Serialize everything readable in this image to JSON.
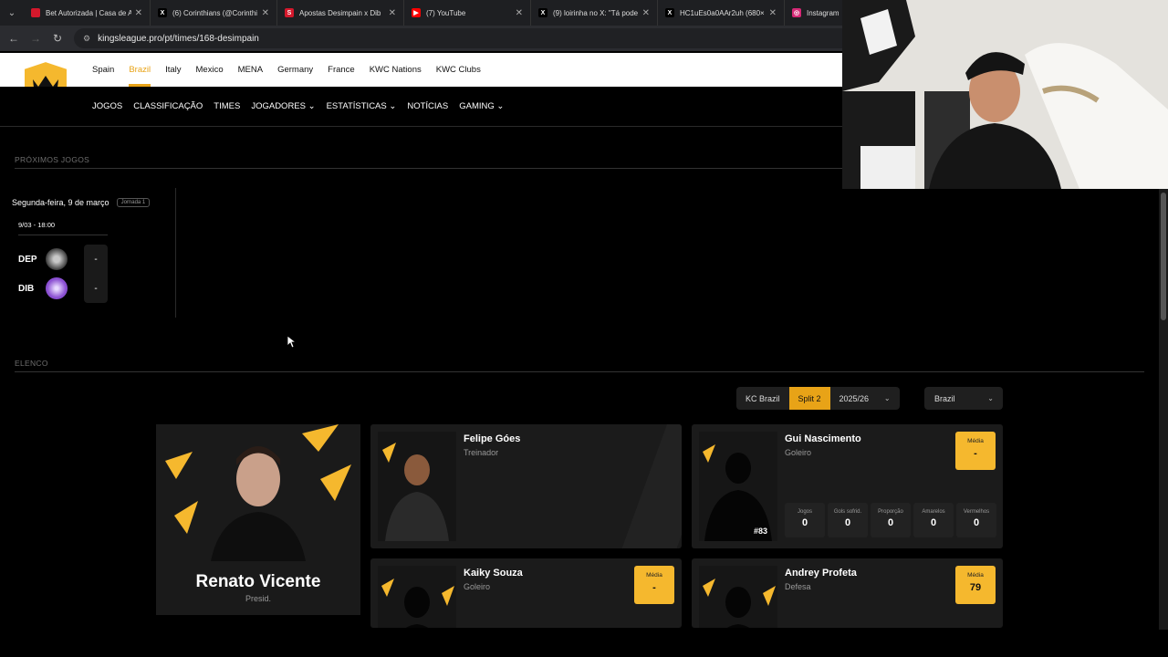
{
  "browser": {
    "tabs": [
      {
        "title": "Bet Autorizada | Casa de A",
        "icon_color": "#d4182c",
        "glyph": ""
      },
      {
        "title": "(6) Corinthians (@Corinthi",
        "icon_color": "#000000",
        "glyph": "X"
      },
      {
        "title": "Apostas Desimpain x Dib",
        "icon_color": "#d4182c",
        "glyph": "S"
      },
      {
        "title": "(7) YouTube",
        "icon_color": "#ff0000",
        "glyph": "▶"
      },
      {
        "title": "(9) loirinha no X: \"Tá pode",
        "icon_color": "#000000",
        "glyph": "X"
      },
      {
        "title": "HC1uEs0a0AAr2uh (680×",
        "icon_color": "#000000",
        "glyph": "X"
      },
      {
        "title": "Instagram",
        "icon_color": "#d62976",
        "glyph": "◎"
      }
    ],
    "url": "kingsleague.pro/pt/times/168-desimpain"
  },
  "site": {
    "regions": [
      "Spain",
      "Brazil",
      "Italy",
      "Mexico",
      "MENA",
      "Germany",
      "France",
      "KWC Nations",
      "KWC Clubs"
    ],
    "active_region": "Brazil",
    "main_nav": [
      "JOGOS",
      "CLASSIFICAÇÃO",
      "TIMES",
      "JOGADORES ⌄",
      "ESTATÍSTICAS ⌄",
      "NOTÍCIAS",
      "GAMING ⌄"
    ]
  },
  "upcoming": {
    "title": "PRÓXIMOS JOGOS",
    "date": "Segunda-feira, 9 de março",
    "badge": "Jornada 1",
    "time": "9/03 - 18:00",
    "home": {
      "abbr": "DEP",
      "score": "-",
      "color": "#c8c8c8"
    },
    "away": {
      "abbr": "DIB",
      "score": "-",
      "color": "#8a4fd1"
    }
  },
  "squad": {
    "title": "ELENCO",
    "filters": {
      "league": "KC Brazil",
      "split": "Split 2",
      "season": "2025/26",
      "country": "Brazil"
    },
    "president": {
      "name": "Renato Vicente",
      "role": "Presid."
    },
    "cards": [
      {
        "name": "Felipe Góes",
        "role": "Treinador"
      },
      {
        "name": "Gui Nascimento",
        "role": "Goleiro",
        "media_label": "Média",
        "media": "-",
        "number": "#83",
        "stats": [
          {
            "label": "Jogos",
            "value": "0"
          },
          {
            "label": "Gols sofrid.",
            "value": "0"
          },
          {
            "label": "Proporção",
            "value": "0"
          },
          {
            "label": "Amarelos",
            "value": "0"
          },
          {
            "label": "Vermelhos",
            "value": "0"
          }
        ]
      },
      {
        "name": "Kaiky Souza",
        "role": "Goleiro",
        "media_label": "Média",
        "media": "-"
      },
      {
        "name": "Andrey Profeta",
        "role": "Defesa",
        "media_label": "Média",
        "media": "79"
      }
    ]
  }
}
